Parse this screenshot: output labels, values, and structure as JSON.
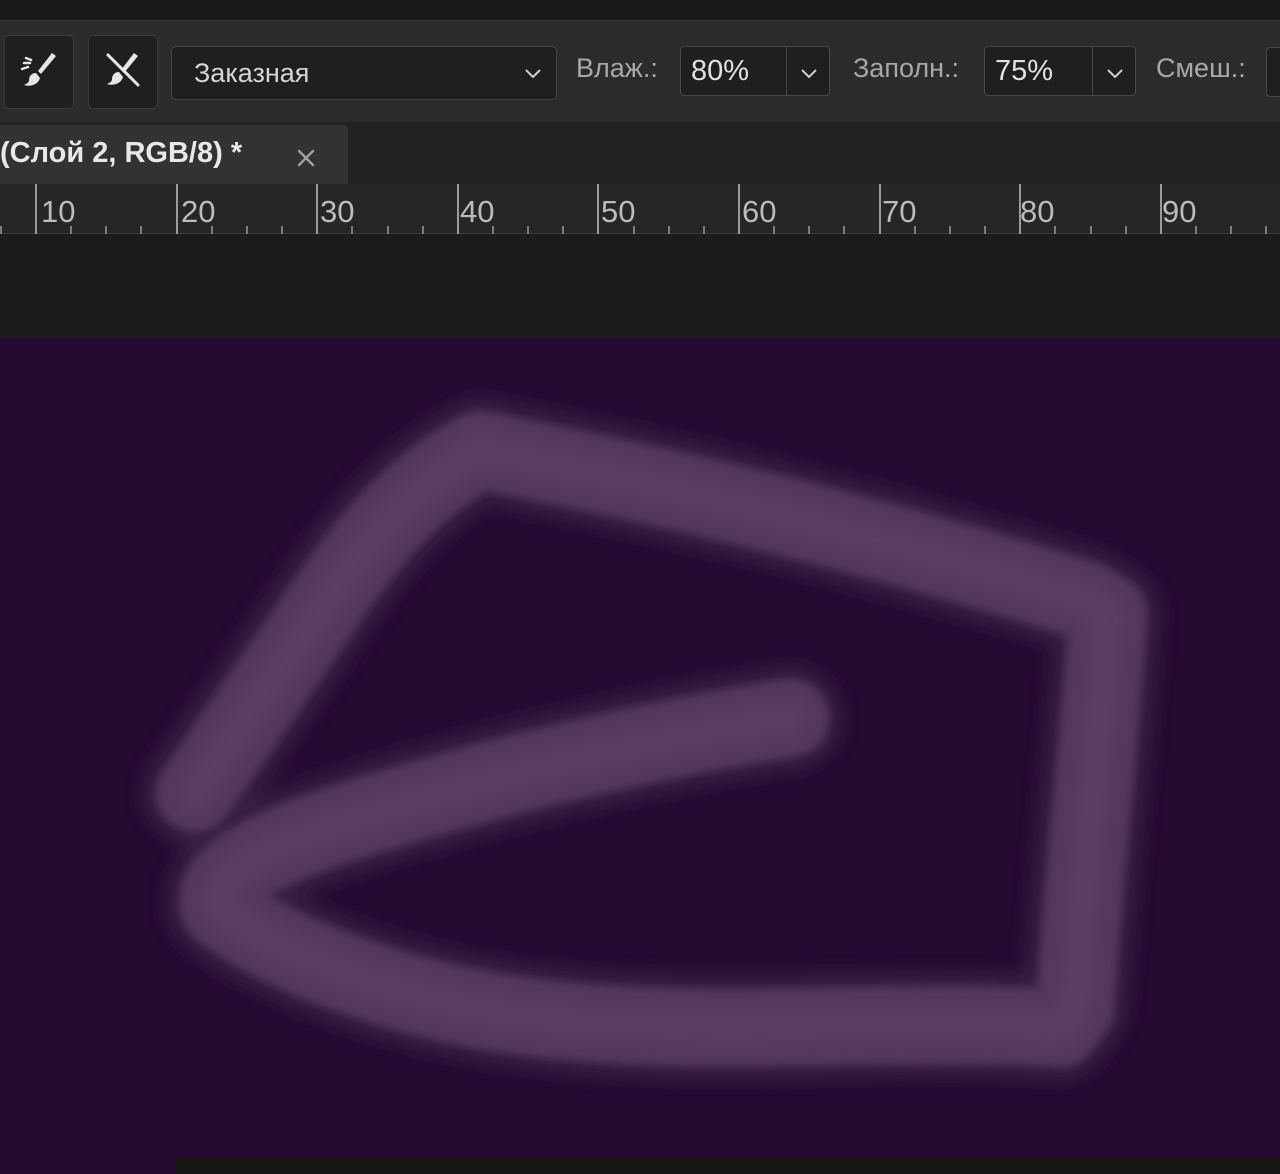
{
  "options_bar": {
    "tools": [
      {
        "name": "sample-all-layers-brush-icon"
      },
      {
        "name": "clean-brush-after-stroke-icon"
      }
    ],
    "preset": {
      "value": "Заказная",
      "icon": "chevron-down-icon"
    },
    "wet": {
      "label": "Влаж.:",
      "value": "80%"
    },
    "load": {
      "label": "Заполн.:",
      "value": "75%"
    },
    "mix": {
      "label": "Смеш.:"
    }
  },
  "document_tab": {
    "title": "(Слой 2, RGB/8) *",
    "close_icon": "close-icon"
  },
  "ruler": {
    "labels": [
      "10",
      "20",
      "30",
      "40",
      "50",
      "60",
      "70",
      "80",
      "90"
    ]
  },
  "canvas": {
    "background_color": "#250b32",
    "stroke_color": "#53385f",
    "stroke_edge_color": "#3a2046"
  },
  "colors": {
    "ui_panel": "#2b2b2b",
    "ui_field": "#1f1f1f",
    "ui_text": "#d6d6d6"
  }
}
